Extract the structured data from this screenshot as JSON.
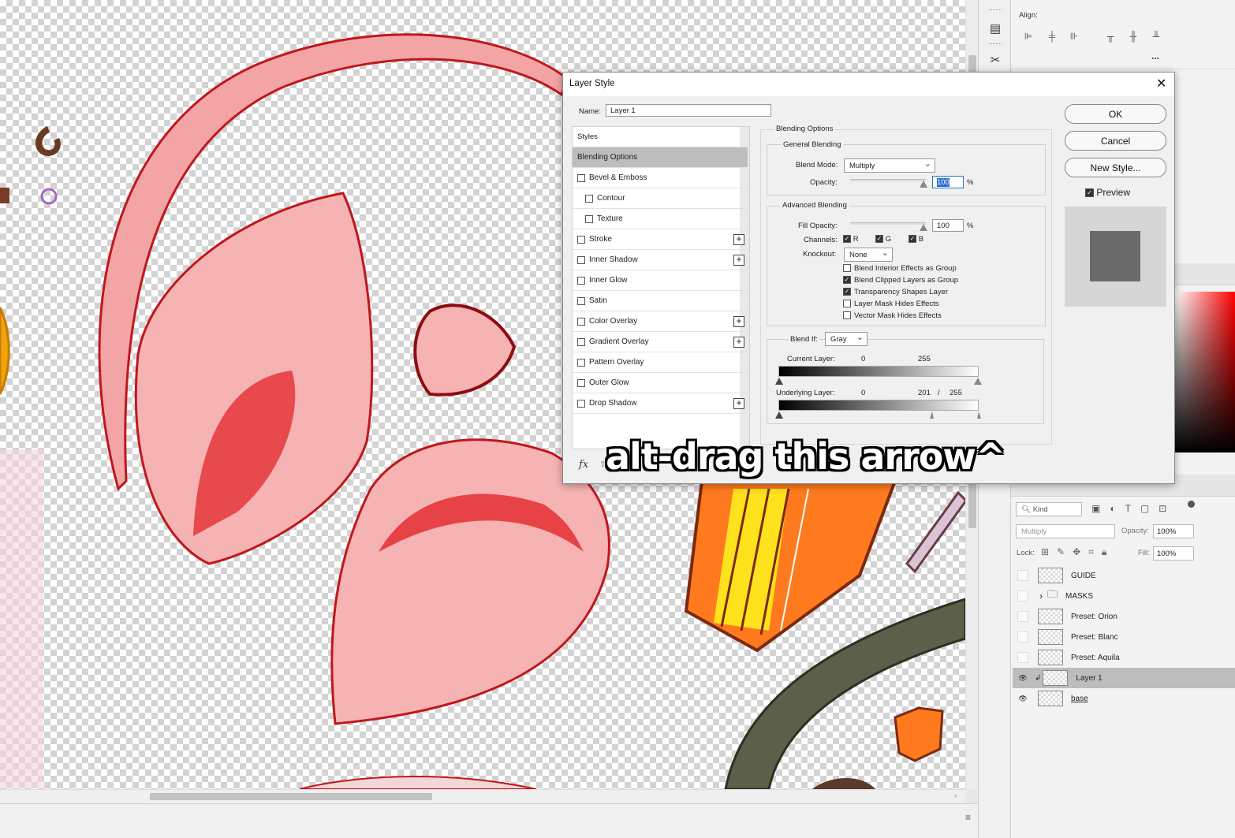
{
  "dialog": {
    "title": "Layer Style",
    "name_label": "Name:",
    "name_value": "Layer 1",
    "styles_header": "Styles",
    "styles_list": [
      {
        "label": "Blending Options",
        "checkbox": false,
        "plus": false,
        "selected": true
      },
      {
        "label": "Bevel & Emboss",
        "checkbox": true,
        "plus": false
      },
      {
        "label": "Contour",
        "checkbox": true,
        "plus": false,
        "indent": true
      },
      {
        "label": "Texture",
        "checkbox": true,
        "plus": false,
        "indent": true
      },
      {
        "label": "Stroke",
        "checkbox": true,
        "plus": true
      },
      {
        "label": "Inner Shadow",
        "checkbox": true,
        "plus": true
      },
      {
        "label": "Inner Glow",
        "checkbox": true,
        "plus": false
      },
      {
        "label": "Satin",
        "checkbox": true,
        "plus": false
      },
      {
        "label": "Color Overlay",
        "checkbox": true,
        "plus": true
      },
      {
        "label": "Gradient Overlay",
        "checkbox": true,
        "plus": true
      },
      {
        "label": "Pattern Overlay",
        "checkbox": true,
        "plus": false
      },
      {
        "label": "Outer Glow",
        "checkbox": true,
        "plus": false
      },
      {
        "label": "Drop Shadow",
        "checkbox": true,
        "plus": true
      }
    ],
    "fx_label": "fx",
    "blending_options_title": "Blending Options",
    "general_blending_title": "General Blending",
    "blend_mode_label": "Blend Mode:",
    "blend_mode_value": "Multiply",
    "opacity_label": "Opacity:",
    "opacity_value": "100",
    "percent": "%",
    "advanced_blending_title": "Advanced Blending",
    "fill_opacity_label": "Fill Opacity:",
    "fill_opacity_value": "100",
    "channels_label": "Channels:",
    "channels": [
      "R",
      "G",
      "B"
    ],
    "knockout_label": "Knockout:",
    "knockout_value": "None",
    "adv_options": [
      {
        "label": "Blend Interior Effects as Group",
        "checked": false
      },
      {
        "label": "Blend Clipped Layers as Group",
        "checked": true
      },
      {
        "label": "Transparency Shapes Layer",
        "checked": true
      },
      {
        "label": "Layer Mask Hides Effects",
        "checked": false
      },
      {
        "label": "Vector Mask Hides Effects",
        "checked": false
      }
    ],
    "blend_if_label": "Blend If:",
    "blend_if_value": "Gray",
    "current_layer_label": "Current Layer:",
    "current_layer_low": "0",
    "current_layer_high": "255",
    "underlying_layer_label": "Underlying Layer:",
    "underlying_low": "0",
    "underlying_split": "201",
    "underlying_sep": "/",
    "underlying_high": "255",
    "ok_label": "OK",
    "cancel_label": "Cancel",
    "new_style_label": "New Style...",
    "preview_label": "Preview"
  },
  "caption": "alt-drag this arrow^",
  "panels": {
    "align_label": "Align:",
    "more_label": "...",
    "kind_label": "Kind",
    "blend_mode": "Multiply",
    "opacity_label": "Opacity:",
    "opacity_value": "100%",
    "lock_label": "Lock:",
    "fill_label": "Fill:",
    "fill_value": "100%",
    "layers": [
      {
        "name": "GUIDE",
        "visible": false,
        "folder": false
      },
      {
        "name": "MASKS",
        "visible": false,
        "folder": true
      },
      {
        "name": "Preset: Orion",
        "visible": false,
        "folder": false
      },
      {
        "name": "Preset: Blanc",
        "visible": false,
        "folder": false
      },
      {
        "name": "Preset: Aquila",
        "visible": false,
        "folder": false
      },
      {
        "name": "Layer 1",
        "visible": true,
        "folder": false,
        "selected": true,
        "clipped": true
      },
      {
        "name": "base",
        "visible": true,
        "folder": false
      }
    ]
  },
  "colors": {
    "accent_red": "#e3262b",
    "dialog_bg": "#f0f0f0",
    "selected_row": "#bdbdbd"
  }
}
